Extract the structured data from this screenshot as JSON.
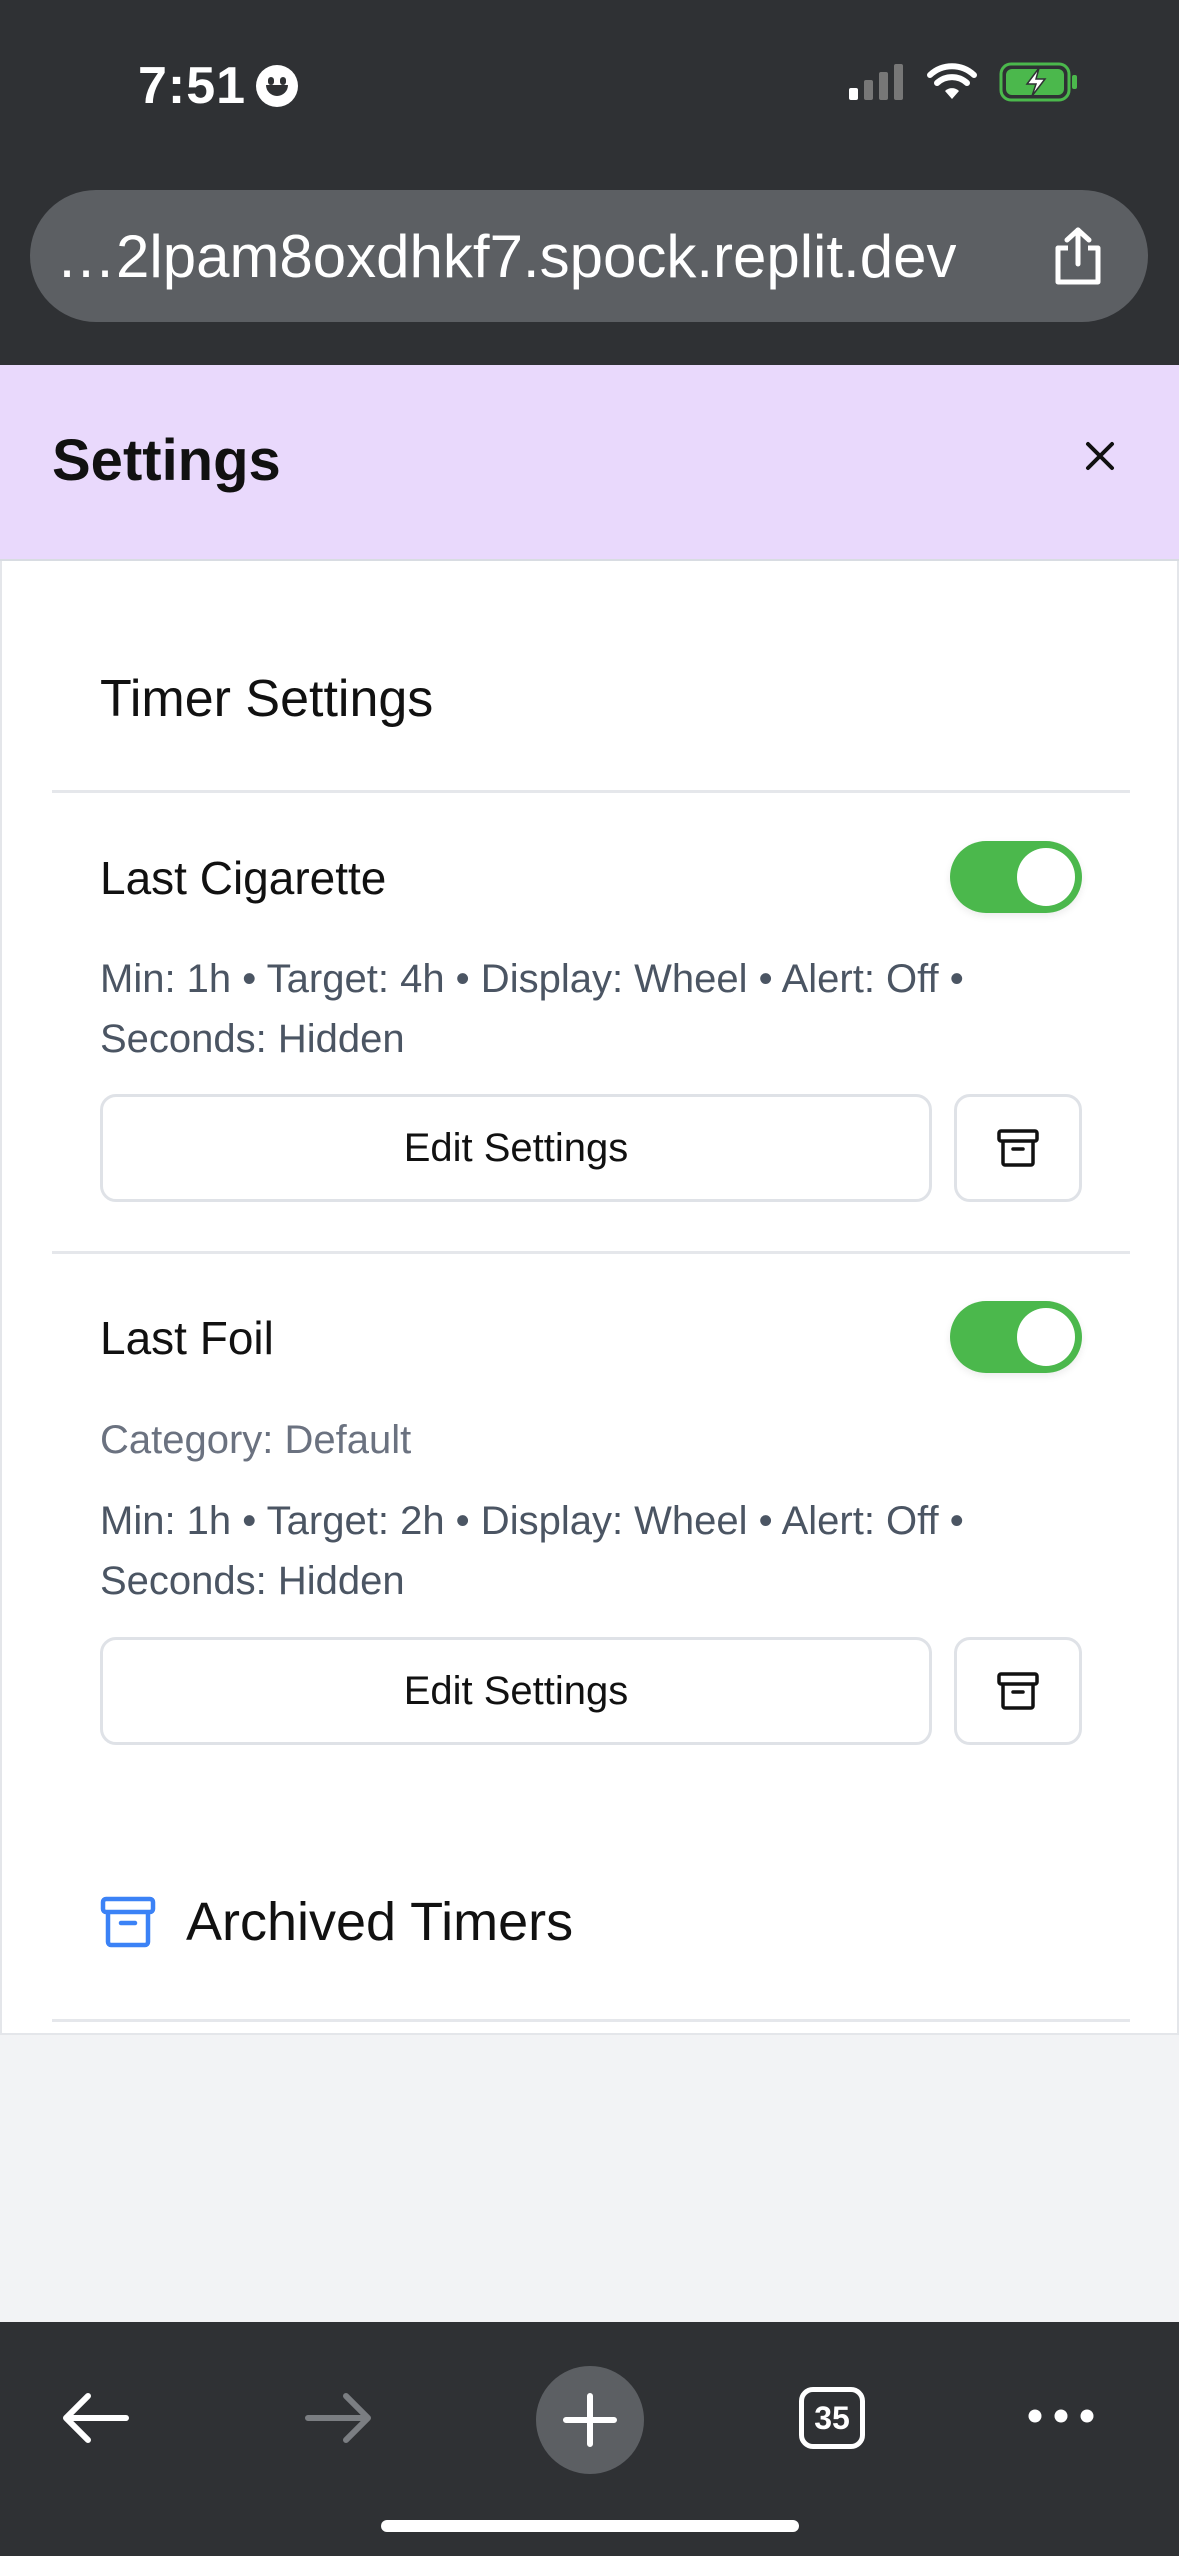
{
  "status_bar": {
    "time": "7:51"
  },
  "browser": {
    "url": "…2lpam8oxdhkf7.spock.replit.dev",
    "tab_count": "35"
  },
  "header": {
    "title": "Settings"
  },
  "section": {
    "title": "Timer Settings"
  },
  "timers": [
    {
      "name": "Last Cigarette",
      "enabled": true,
      "details_line1": "Min: 1h • Target: 4h • Display: Wheel • Alert: Off •",
      "details_line2": "Seconds: Hidden",
      "edit_label": "Edit Settings"
    },
    {
      "name": "Last Foil",
      "enabled": true,
      "category": "Category: Default",
      "details_line1": "Min: 1h • Target: 2h • Display: Wheel • Alert: Off •",
      "details_line2": "Seconds: Hidden",
      "edit_label": "Edit Settings"
    }
  ],
  "archived": {
    "label": "Archived Timers"
  },
  "colors": {
    "header_bg": "#e9d9fc",
    "toggle_on": "#4bb84c",
    "archive_accent": "#3b82f6",
    "chrome_bg": "#2f3134"
  }
}
